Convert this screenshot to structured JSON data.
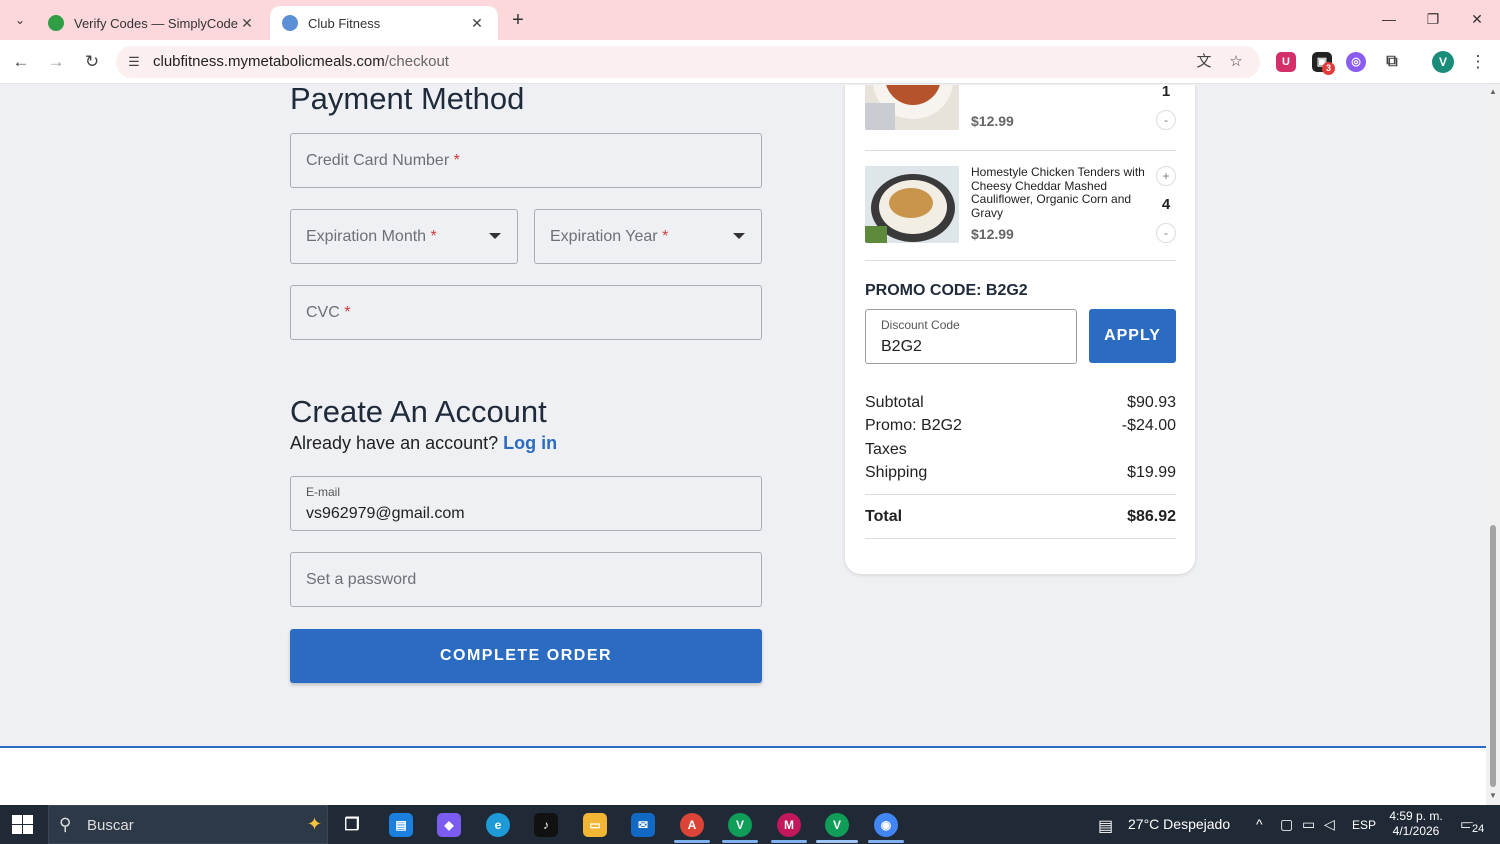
{
  "browser": {
    "tabs": [
      {
        "title": "Verify Codes — SimplyCodes",
        "active": false,
        "favicon_color": "#2f9e44"
      },
      {
        "title": "Club Fitness",
        "active": true,
        "favicon_color": "#5b8fd6"
      }
    ],
    "url_host": "clubfitness.mymetabolicmeals.com",
    "url_path": "/checkout",
    "profile_initial": "V",
    "extension_badge": "3"
  },
  "payment": {
    "heading": "Payment Method",
    "card_number_placeholder": "Credit Card Number",
    "exp_month_placeholder": "Expiration Month",
    "exp_year_placeholder": "Expiration Year",
    "cvc_placeholder": "CVC",
    "required_mark": "*"
  },
  "account": {
    "heading": "Create An Account",
    "already_text": "Already have an account?",
    "login_link": "Log in",
    "email_label": "E-mail",
    "email_value": "vs962979@gmail.com",
    "password_placeholder": "Set a password"
  },
  "complete_button": "COMPLETE ORDER",
  "cart": {
    "items": [
      {
        "name": "",
        "price": "$12.99",
        "qty": "1",
        "minus": "-"
      },
      {
        "name": "Homestyle Chicken Tenders with Cheesy Cheddar Mashed Cauliflower, Organic Corn and Gravy",
        "price": "$12.99",
        "qty": "4",
        "plus": "+",
        "minus": "-"
      }
    ],
    "promo_title": "PROMO CODE: B2G2",
    "discount_label": "Discount Code",
    "discount_value": "B2G2",
    "apply_button": "APPLY",
    "summary": [
      {
        "label": "Subtotal",
        "amount": "$90.93"
      },
      {
        "label": "Promo: B2G2",
        "amount": "-$24.00"
      },
      {
        "label": "Taxes",
        "amount": ""
      },
      {
        "label": "Shipping",
        "amount": "$19.99"
      }
    ],
    "total_label": "Total",
    "total_amount": "$86.92"
  },
  "taskbar": {
    "search_placeholder": "Buscar",
    "weather": "27°C Despejado",
    "language": "ESP",
    "time": "4:59 p. m.",
    "date": "4/1/2026",
    "notifications": "24"
  }
}
